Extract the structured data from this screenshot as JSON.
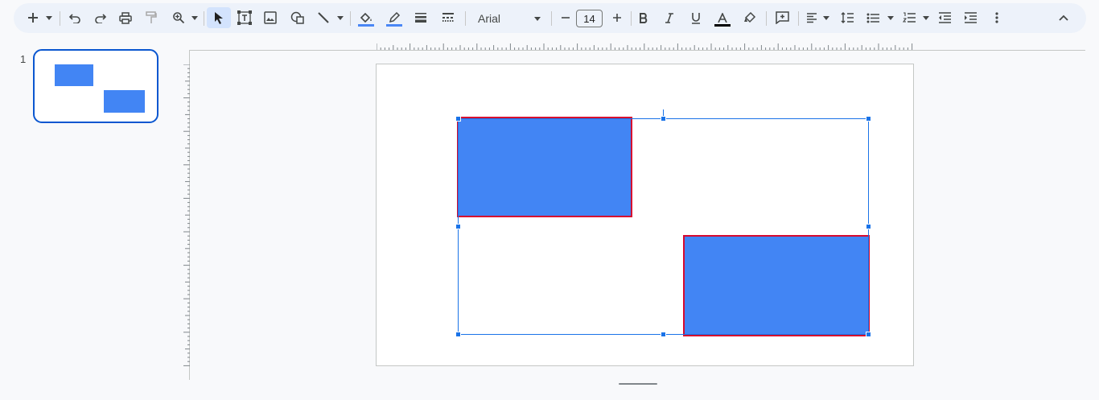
{
  "toolbar": {
    "font_name": "Arial",
    "font_size": "14",
    "fill_color": "#4a87f5",
    "border_color": "#4a87f5",
    "text_color": "#000000",
    "icons": [
      "new-slide-icon",
      "undo-icon",
      "redo-icon",
      "print-icon",
      "paint-format-icon",
      "zoom-icon",
      "select-icon",
      "text-box-icon",
      "image-icon",
      "shape-icon",
      "line-icon",
      "fill-color-icon",
      "border-color-icon",
      "border-weight-icon",
      "border-dash-icon",
      "font-size-decrease-icon",
      "font-size-increase-icon",
      "bold-icon",
      "italic-icon",
      "underline-icon",
      "text-color-icon",
      "highlight-icon",
      "insert-comment-icon",
      "align-icon",
      "line-spacing-icon",
      "bulleted-list-icon",
      "numbered-list-icon",
      "decrease-indent-icon",
      "increase-indent-icon",
      "more-icon",
      "collapse-icon"
    ]
  },
  "filmstrip": {
    "slide_number": "1"
  },
  "canvas": {
    "shape_fill": "#4285f4",
    "shape_border": "#d6092f",
    "selection_color": "#1a73e8"
  }
}
